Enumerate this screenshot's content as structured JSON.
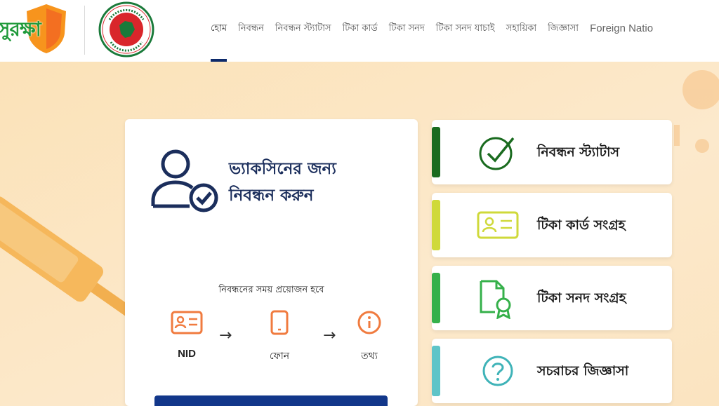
{
  "brand": {
    "logo_text": "সুরক্ষা",
    "seal_icon": "bangladesh-government-seal"
  },
  "nav": {
    "items": [
      {
        "label": "হোম",
        "active": true
      },
      {
        "label": "নিবন্ধন"
      },
      {
        "label": "নিবন্ধন স্ট্যাটাস"
      },
      {
        "label": "টিকা কার্ড"
      },
      {
        "label": "টিকা সনদ"
      },
      {
        "label": "টিকা সনদ যাচাই"
      },
      {
        "label": "সহায়িকা"
      },
      {
        "label": "জিজ্ঞাসা"
      },
      {
        "label": "Foreign Natio"
      }
    ]
  },
  "registration": {
    "title_line1": "ভ্যাকসিনের জন্য",
    "title_line2": "নিবন্ধন করুন",
    "requirements_text": "নিবন্ধনের সময় প্রয়োজন হবে",
    "steps": [
      {
        "label": "NID",
        "icon": "id-card-icon"
      },
      {
        "label": "ফোন",
        "icon": "phone-icon"
      },
      {
        "label": "তথ্য",
        "icon": "info-icon"
      }
    ],
    "arrow": "→"
  },
  "actions": [
    {
      "label": "নিবন্ধন স্ট্যাটাস",
      "icon": "check-circle-icon",
      "color": "#1a6b1f"
    },
    {
      "label": "টিকা কার্ড সংগ্রহ",
      "icon": "id-card-icon",
      "color": "#cfd93a"
    },
    {
      "label": "টিকা সনদ সংগ্রহ",
      "icon": "certificate-icon",
      "color": "#35b04a"
    },
    {
      "label": "সচরাচর জিজ্ঞাসা",
      "icon": "question-icon",
      "color": "#5ec4c8"
    }
  ],
  "colors": {
    "brand_green": "#1f9a3a",
    "brand_orange": "#f7941d",
    "navy": "#12378a",
    "step_orange": "#f07b3f",
    "background": "#fbe6c4"
  }
}
